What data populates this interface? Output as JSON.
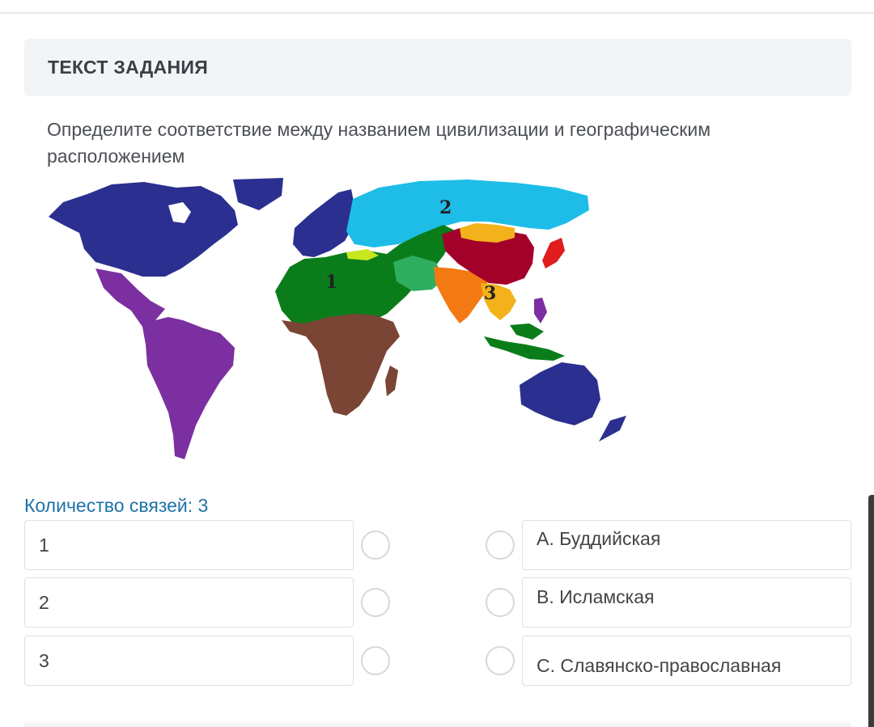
{
  "task": {
    "header": "ТЕКСТ ЗАДАНИЯ",
    "question": "Определите соответствие между названием цивилизации и географическим расположением"
  },
  "map": {
    "labels": [
      "1",
      "2",
      "3"
    ],
    "colors": {
      "western": "#2b2f8f",
      "latin": "#7b2fa0",
      "african": "#7a4535",
      "islamic": "#0a7d1a",
      "orthodox": "#1ebde8",
      "chinese": "#a3002a",
      "buddhist": "#f3b21b",
      "hindu": "#f37a12",
      "japanese": "#e01c1c"
    }
  },
  "matching": {
    "links_count": "Количество связей: 3",
    "left": [
      "1",
      "2",
      "3"
    ],
    "right": [
      "А. Буддийская",
      "В. Исламская",
      "С. Славянско-православная"
    ]
  }
}
